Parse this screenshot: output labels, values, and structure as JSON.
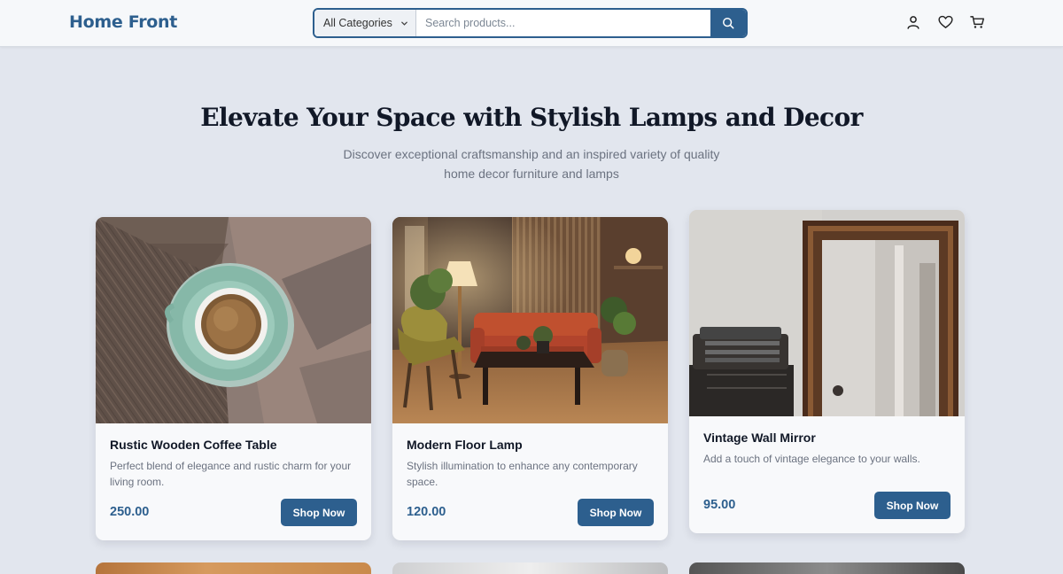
{
  "header": {
    "logo": "Home Front",
    "category_select": "All Categories",
    "search_placeholder": "Search products...",
    "icons": [
      "user-icon",
      "heart-icon",
      "cart-icon"
    ]
  },
  "hero": {
    "title": "Elevate Your Space with Stylish Lamps and Decor",
    "subtitle": "Discover exceptional craftsmanship and an inspired variety of quality home decor furniture and lamps"
  },
  "products": [
    {
      "title": "Rustic Wooden Coffee Table",
      "description": "Perfect blend of elegance and rustic charm for your living room.",
      "price": "250.00",
      "button": "Shop Now"
    },
    {
      "title": "Modern Floor Lamp",
      "description": "Stylish illumination to enhance any contemporary space.",
      "price": "120.00",
      "button": "Shop Now"
    },
    {
      "title": "Vintage Wall Mirror",
      "description": "Add a touch of vintage elegance to your walls.",
      "price": "95.00",
      "button": "Shop Now"
    }
  ],
  "colors": {
    "brand": "#2d5f8e",
    "page_bg": "#e2e6ee",
    "card_bg": "#f8f9fb"
  }
}
